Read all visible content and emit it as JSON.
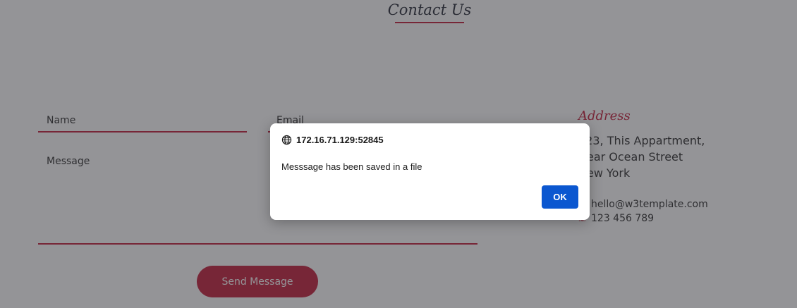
{
  "section": {
    "title": "Contact Us"
  },
  "form": {
    "name_placeholder": "Name",
    "email_placeholder": "Email",
    "message_placeholder": "Message",
    "send_label": "Send Message"
  },
  "address": {
    "heading": "Address",
    "lines": [
      "123, This Appartment,",
      "Near Ocean Street",
      "New York"
    ],
    "email": "hello@w3template.com",
    "phone": "123 456 789"
  },
  "dialog": {
    "origin": "172.16.71.129:52845",
    "message": "Messsage has been saved in a file",
    "ok_label": "OK"
  },
  "colors": {
    "accent": "#c4233f",
    "dialog_button": "#0b57d0"
  },
  "icons": {
    "email": "envelope-icon",
    "phone": "phone-icon",
    "origin": "globe-icon"
  }
}
